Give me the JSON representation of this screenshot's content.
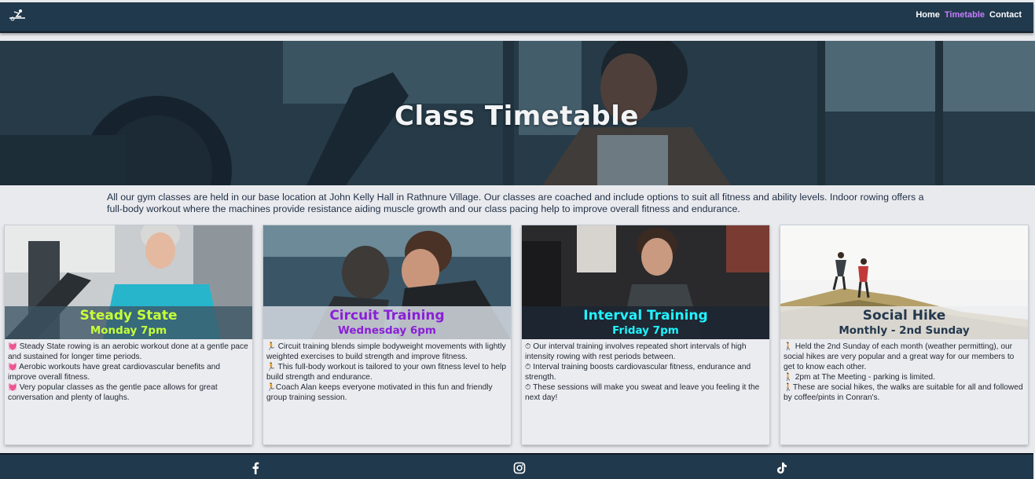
{
  "nav": {
    "logo_icon": "rower-icon",
    "links": [
      {
        "label": "Home",
        "color": "#ffffff"
      },
      {
        "label": "Timetable",
        "color": "#c77dff"
      },
      {
        "label": "Contact",
        "color": "#ffffff"
      }
    ]
  },
  "hero": {
    "title": "Class Timetable"
  },
  "intro": "All our gym classes are held in our base location at John Kelly Hall in Rathnure Village. Our classes are coached and include options to suit all fitness and ability levels. Indoor rowing offers a full-body workout where the machines provide resistance aiding muscle growth and our class pacing help to improve overall fitness and endurance.",
  "cards": [
    {
      "name": "Steady State",
      "time": "Monday 7pm",
      "title_color": "#c6ff3a",
      "icon": "heart-pulse-icon",
      "lines": [
        "Steady State rowing is an aerobic workout done at a gentle pace and sustained for longer time periods.",
        "Aerobic workouts have great cardiovascular benefits and improve overall fitness.",
        "Very popular classes as the gentle pace allows for great conversation and plenty of laughs."
      ]
    },
    {
      "name": "Circuit Training",
      "time": "Wednesday 6pm",
      "title_color": "#8a1fd6",
      "icon": "runner-icon",
      "lines": [
        "Circuit training blends simple bodyweight movements with lightly weighted exercises to build strength and improve fitness.",
        "This full-body workout is tailored to your own fitness level to help build strength and endurance.",
        "Coach Alan keeps everyone motivated in this fun and friendly group training session."
      ]
    },
    {
      "name": "Interval Training",
      "time": "Friday 7pm",
      "title_color": "#21f3ff",
      "icon": "stopwatch-icon",
      "lines": [
        "Our interval training involves repeated short intervals of high intensity rowing with rest periods between.",
        "Interval training boosts cardiovascular fitness, endurance and strength.",
        "These sessions will make you sweat and leave you feeling it the next day!"
      ]
    },
    {
      "name": "Social Hike",
      "time": "Monthly - 2nd Sunday",
      "title_color": "#23384d",
      "icon": "hiker-icon",
      "lines": [
        "Held the 2nd Sunday of each month (weather permitting), our social hikes are very popular and a great way for our members to get to know each other.",
        "2pm at The Meeting - parking is limited.",
        "These are social hikes, the walks are suitable for all and followed by coffee/pints in Conran's."
      ]
    }
  ],
  "footer": {
    "icons": [
      "facebook-icon",
      "instagram-icon",
      "tiktok-icon"
    ]
  }
}
